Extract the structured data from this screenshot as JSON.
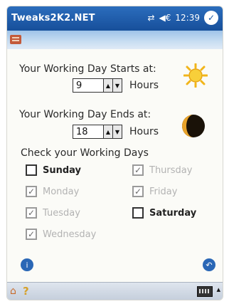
{
  "title_bar": {
    "app_title": "Tweaks2K2.NET",
    "clock": "12:39",
    "ok_icon": "ok-circle-icon",
    "connectivity_icon": "sync-arrows-icon",
    "volume_icon": "speaker-icon"
  },
  "start_section": {
    "label": "Your Working Day Starts at:",
    "value": "9",
    "unit": "Hours",
    "icon": "sun-icon"
  },
  "end_section": {
    "label": "Your Working Day Ends at:",
    "value": "18",
    "unit": "Hours",
    "icon": "moon-icon"
  },
  "days_section": {
    "label": "Check your Working Days",
    "days": [
      {
        "name": "Sunday",
        "checked": false
      },
      {
        "name": "Monday",
        "checked": true
      },
      {
        "name": "Tuesday",
        "checked": true
      },
      {
        "name": "Wednesday",
        "checked": true
      },
      {
        "name": "Thursday",
        "checked": true
      },
      {
        "name": "Friday",
        "checked": true
      },
      {
        "name": "Saturday",
        "checked": false
      }
    ]
  },
  "colors": {
    "title_bar": "#1f5fae",
    "accent": "#2a67b6"
  }
}
